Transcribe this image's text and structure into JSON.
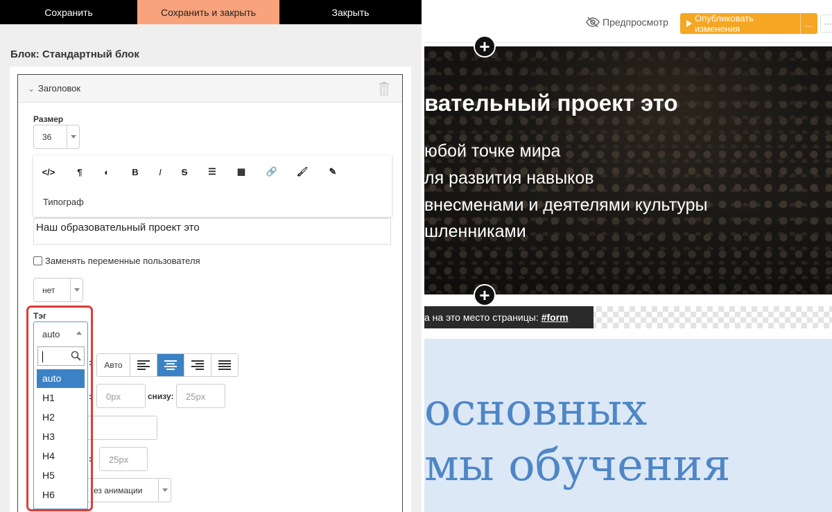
{
  "topbar": {
    "save": "Сохранить",
    "save_close": "Сохранить и закрыть",
    "close": "Закрыть"
  },
  "block_title": "Блок: Стандартный блок",
  "accordion": {
    "title": "Заголовок"
  },
  "size": {
    "label": "Размер",
    "value": "36"
  },
  "toolbar": {
    "icons": [
      "code-icon",
      "paragraph-icon",
      "contrast-icon",
      "bold-icon",
      "italic-icon",
      "strikethrough-icon",
      "list-icon",
      "table-icon",
      "link-icon",
      "brush-icon",
      "pencil-icon"
    ],
    "typograph": "Типограф"
  },
  "heading_text": "Наш образовательный проект это",
  "replace_vars": {
    "label": "Заменять переменные пользователя",
    "checked": false
  },
  "variant_select": {
    "value": "нет"
  },
  "tag": {
    "label": "Тэг",
    "value": "auto",
    "search_placeholder": "",
    "options": [
      "auto",
      "H1",
      "H2",
      "H3",
      "H4",
      "H5",
      "H6"
    ],
    "selected": "auto"
  },
  "align": {
    "auto_label": "Авто",
    "selected": "center"
  },
  "padding": {
    "top_value": "0px",
    "bottom_label": "снизу:",
    "bottom_value": "25px"
  },
  "margin": {
    "value": "25px"
  },
  "animation": {
    "value": "ез анимации"
  },
  "preview": {
    "preview_label": "Предпросмотр",
    "publish_label": "Опубликовать изменения",
    "more": "...",
    "hero_title": "вательный проект это",
    "hero_lines": [
      "юбой точке мира",
      "ля развития навыков",
      "внесменами и деятелями культуры",
      "шленниками"
    ],
    "anchor_text": "а на это место страницы:",
    "anchor_link": "#form",
    "section_lines": [
      "основных",
      "мы обучения"
    ]
  },
  "colors": {
    "accent_orange": "#f8a37c",
    "publish_orange": "#f5a623",
    "highlight_red": "#e03b37",
    "select_blue": "#3b82c4",
    "section_blue": "#4f86c6"
  }
}
